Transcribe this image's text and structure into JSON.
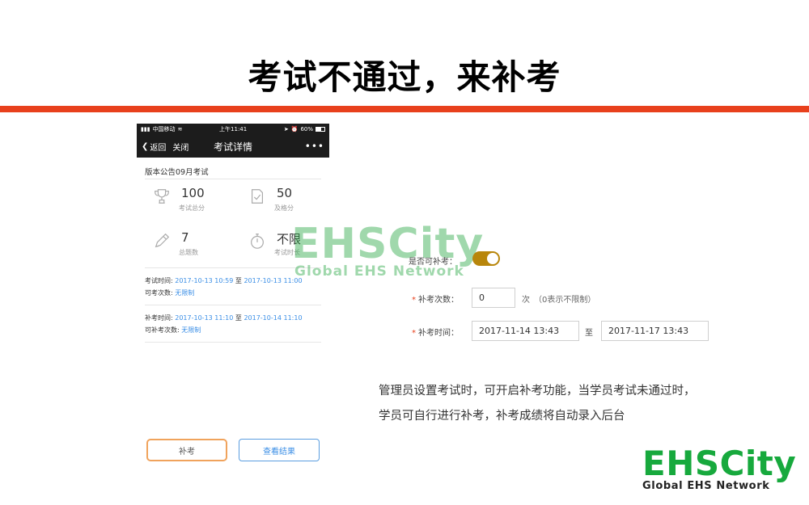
{
  "slide": {
    "title": "考试不通过，来补考",
    "description_line1": "管理员设置考试时，可开启补考功能，当学员考试未通过时，",
    "description_line2": "学员可自行进行补考，补考成绩将自动录入后台"
  },
  "phone": {
    "status": {
      "carrier": "中国移动",
      "time": "上午11:41",
      "battery": "60%"
    },
    "nav": {
      "back": "返回",
      "close": "关闭",
      "title": "考试详情",
      "more": "•••"
    },
    "exam_name": "版本公告09月考试",
    "stats": [
      {
        "value": "100",
        "label": "考试总分",
        "icon": "trophy-icon"
      },
      {
        "value": "50",
        "label": "及格分",
        "icon": "pass-check-icon"
      },
      {
        "value": "7",
        "label": "总题数",
        "icon": "pencil-icon"
      },
      {
        "value": "不限",
        "label": "考试时长",
        "icon": "stopwatch-icon"
      }
    ],
    "exam_info": {
      "time_key": "考试时间:",
      "time_start": "2017-10-13 10:59",
      "time_sep": "至",
      "time_end": "2017-10-13 11:00",
      "count_key": "可考次数:",
      "count_val": "无限制"
    },
    "retake_info": {
      "time_key": "补考时间:",
      "time_start": "2017-10-13 11:10",
      "time_sep": "至",
      "time_end": "2017-10-14 11:10",
      "count_key": "可补考次数:",
      "count_val": "无限制"
    },
    "buttons": {
      "retake": "补考",
      "view_result": "查看结果"
    }
  },
  "settings": {
    "allow_retake_label": "是否可补考：",
    "allow_retake_on": true,
    "retake_count_label": "补考次数：",
    "retake_count_value": "0",
    "retake_count_unit": "次",
    "retake_count_note": "（0表示不限制）",
    "retake_time_label": "补考时间：",
    "retake_time_start": "2017-11-14 13:43",
    "retake_time_sep": "至",
    "retake_time_end": "2017-11-17 13:43"
  },
  "watermark": {
    "big": "EHSCity",
    "small": "Global EHS Network"
  },
  "logo": {
    "big": "EHSCity",
    "small": "Global EHS Network"
  },
  "colors": {
    "accent_red": "#e8401c",
    "link_blue": "#3a8ee6",
    "brand_green": "#17a93d",
    "toggle_on": "#b8860b"
  }
}
